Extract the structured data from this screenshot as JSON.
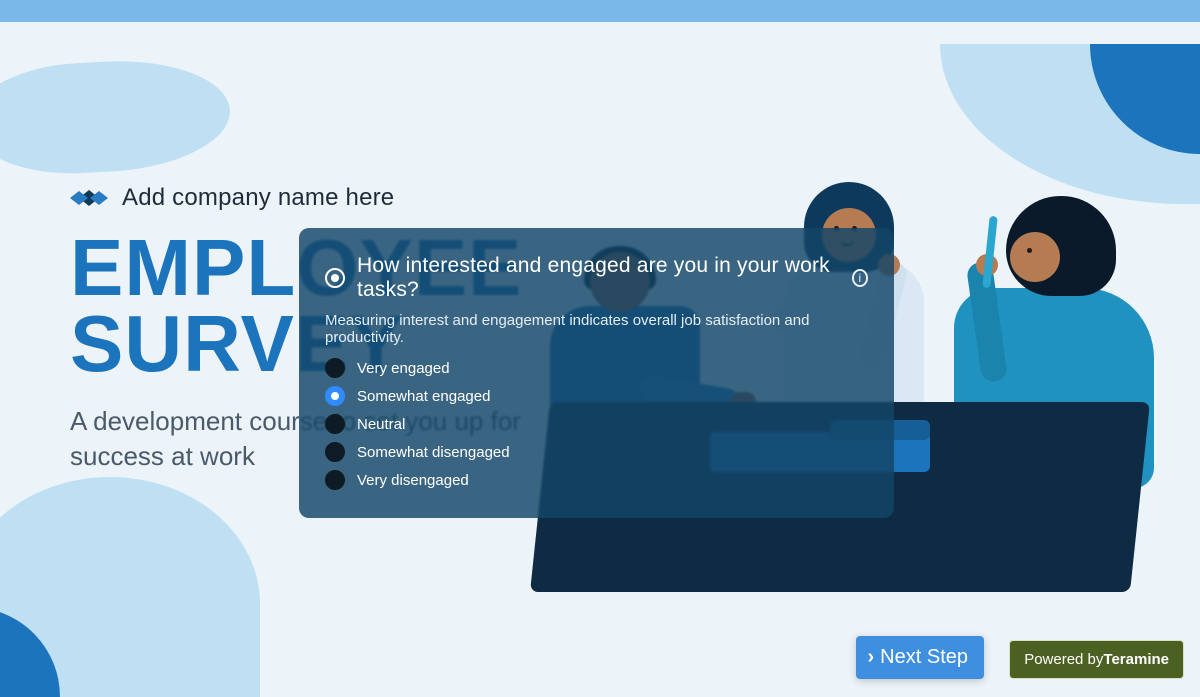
{
  "header": {
    "company_name": "Add company name here"
  },
  "hero": {
    "title_line1": "EMPLOYEE",
    "title_line2": "SURVEY",
    "subtitle": "A development course to set you up for success at work"
  },
  "panel": {
    "question": "How interested and engaged are you in your work tasks?",
    "description": "Measuring interest and engagement indicates overall job satisfaction and productivity.",
    "selected_index": 1,
    "options": [
      {
        "label": "Very engaged"
      },
      {
        "label": "Somewhat engaged"
      },
      {
        "label": "Neutral"
      },
      {
        "label": "Somewhat disengaged"
      },
      {
        "label": "Very disengaged"
      }
    ]
  },
  "footer": {
    "next_label": "Next Step",
    "powered_prefix": "Powered by",
    "powered_brand": "Teramine"
  }
}
